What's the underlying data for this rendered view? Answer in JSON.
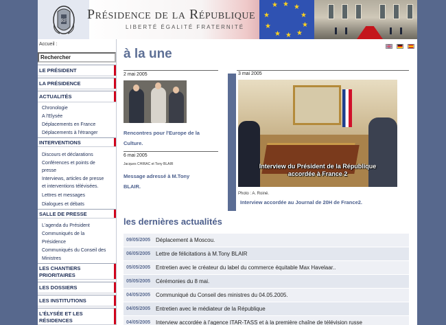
{
  "header": {
    "title": "Présidence de la République",
    "motto": "LIBERTÉ  ÉGALITÉ  FRATERNITÉ",
    "emblem_icon": "rf-emblem-icon"
  },
  "sidebar": {
    "accueil": "Accueil :",
    "search_label": "Rechercher",
    "sections": [
      {
        "label": "LE PRÉSIDENT"
      },
      {
        "label": "LA PRÉSIDENCE"
      },
      {
        "label": "ACTUALITÉS",
        "items": [
          "Chronologie",
          "A l'Elysée",
          "Déplacements en France",
          "Déplacements à l'étranger"
        ]
      },
      {
        "label": "INTERVENTIONS",
        "items": [
          "Discours et déclarations",
          "Conférences et points de",
          "presse",
          "Interviews, articles de presse",
          "et interventions télévisées.",
          "Lettres et messages",
          "Dialogues et débats"
        ]
      },
      {
        "label": "SALLE DE PRESSE",
        "items": [
          "L'agenda du Président",
          "Communiqués de la",
          "Présidence",
          "Communiqués du Conseil des",
          "Ministres"
        ]
      },
      {
        "label": "LES CHANTIERS",
        "label2": "PRIORITAIRES"
      },
      {
        "label": "LES DOSSIERS"
      },
      {
        "label": "LES INSTITUTIONS"
      },
      {
        "label": "L'ÉLYSÉE ET LES",
        "label2": "RÉSIDENCES"
      }
    ]
  },
  "main": {
    "title": "à la une",
    "languages": [
      {
        "name": "english-flag-icon"
      },
      {
        "name": "german-flag-icon"
      },
      {
        "name": "spanish-flag-icon"
      }
    ],
    "featured": [
      {
        "date": "2 mai 2005",
        "link_line1": "Rencontres pour l'Europe de la",
        "link_line2": "Culture."
      },
      {
        "date": "6 mai 2005",
        "caption": "Jacques CHIRAC et Tony BLAIR",
        "link_line1": "Message adressé à M.Tony",
        "link_line2": "BLAIR."
      }
    ],
    "video": {
      "date": "3 mai 2005",
      "overlay_line1": "Interview du Président de la République",
      "overlay_line2": "accordée à France 2",
      "credit": "Photo : A. Roiné.",
      "link": "Interview accordée au Journal de 20H de France2."
    },
    "news_title": "les dernières actualités",
    "news": [
      {
        "date": "09/05/2005",
        "title": "Déplacement à Moscou."
      },
      {
        "date": "06/05/2005",
        "title": "Lettre de félicitations à M.Tony BLAIR"
      },
      {
        "date": "05/05/2005",
        "title": "Entretien avec le créateur du label du commerce équitable Max Havelaar.."
      },
      {
        "date": "05/05/2005",
        "title": "Cérémonies du 8 mai."
      },
      {
        "date": "04/05/2005",
        "title": "Communiqué du Conseil des ministres du 04.05.2005."
      },
      {
        "date": "04/05/2005",
        "title": "Entretien avec le médiateur de la République"
      },
      {
        "date": "04/05/2005",
        "title": "Interview accordée à l'agence ITAR-TASS et à la première chaîne de télévision russe"
      }
    ]
  }
}
